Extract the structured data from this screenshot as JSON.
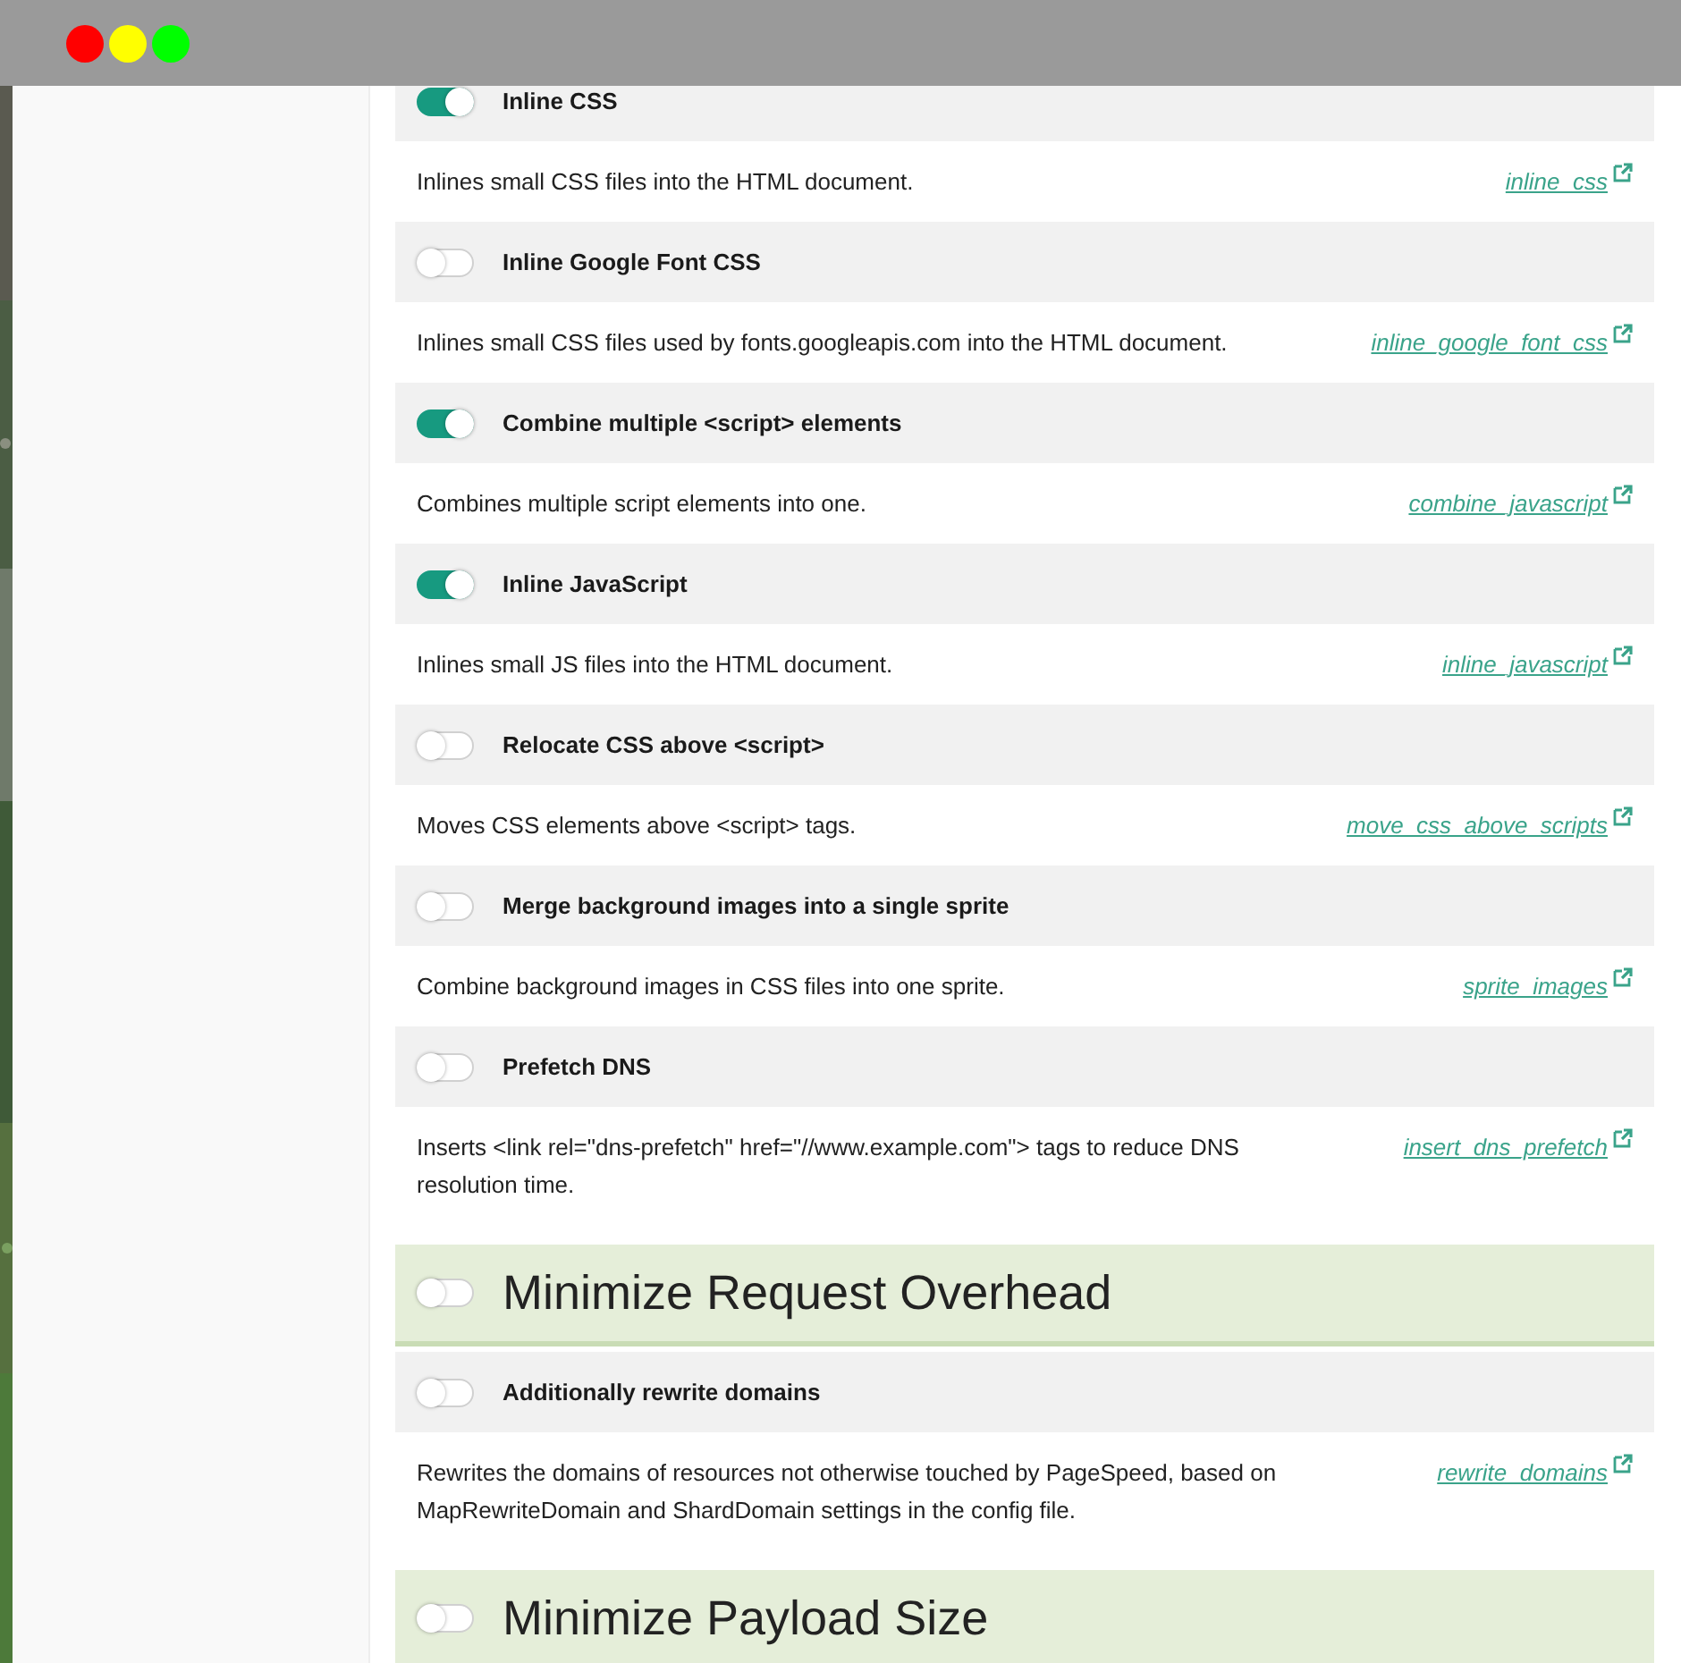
{
  "items": [
    {
      "kind": "option",
      "title": "Inline CSS",
      "on": true,
      "description": "Inlines small CSS files into the HTML document.",
      "link": "inline_css"
    },
    {
      "kind": "option",
      "title": "Inline Google Font CSS",
      "on": false,
      "description": "Inlines small CSS files used by fonts.googleapis.com into the HTML document.",
      "link": "inline_google_font_css"
    },
    {
      "kind": "option",
      "title": "Combine multiple <script> elements",
      "on": true,
      "description": "Combines multiple script elements into one.",
      "link": "combine_javascript"
    },
    {
      "kind": "option",
      "title": "Inline JavaScript",
      "on": true,
      "description": "Inlines small JS files into the HTML document.",
      "link": "inline_javascript"
    },
    {
      "kind": "option",
      "title": "Relocate CSS above <script>",
      "on": false,
      "description": "Moves CSS elements above <script> tags.",
      "link": "move_css_above_scripts"
    },
    {
      "kind": "option",
      "title": "Merge background images into a single sprite",
      "on": false,
      "description": "Combine background images in CSS files into one sprite.",
      "link": "sprite_images"
    },
    {
      "kind": "option",
      "title": "Prefetch DNS",
      "on": false,
      "description": "Inserts <link rel=\"dns-prefetch\" href=\"//www.example.com\"> tags to reduce DNS resolution time.",
      "link": "insert_dns_prefetch"
    },
    {
      "kind": "section",
      "title": "Minimize Request Overhead",
      "on": false
    },
    {
      "kind": "option",
      "title": "Additionally rewrite domains",
      "on": false,
      "description": "Rewrites the domains of resources not otherwise touched by PageSpeed, based on MapRewriteDomain and ShardDomain settings in the config file.",
      "link": "rewrite_domains"
    },
    {
      "kind": "section",
      "title": "Minimize Payload Size",
      "on": false
    }
  ]
}
